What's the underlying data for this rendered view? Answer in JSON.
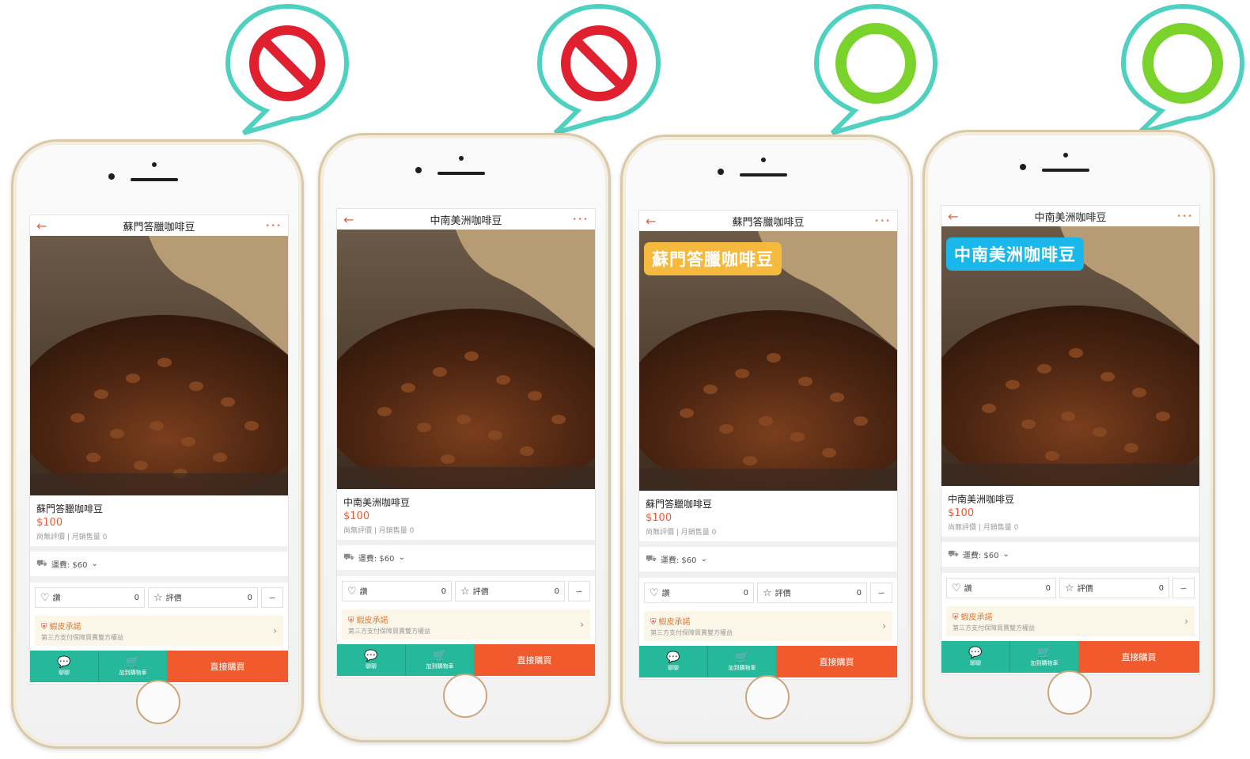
{
  "phones": [
    {
      "badge": "prohibited",
      "nav_title": "蘇門答臘咖啡豆",
      "overlay_tag": "",
      "product_name": "蘇門答臘咖啡豆",
      "price": "$100",
      "meta": "尚無評價 | 月銷售量 0",
      "shipping": "運費: $60",
      "like_label": "讚",
      "like_count": "0",
      "rating_label": "評價",
      "rating_count": "0",
      "promise_title": "蝦皮承諾",
      "promise_sub": "第三方支付保障買賣雙方權益",
      "chat_label": "聊聊",
      "cart_label": "加到購物車",
      "buy_label": "直接購買"
    },
    {
      "badge": "prohibited",
      "nav_title": "中南美洲咖啡豆",
      "overlay_tag": "",
      "product_name": "中南美洲咖啡豆",
      "price": "$100",
      "meta": "尚無評價 | 月銷售量 0",
      "shipping": "運費: $60",
      "like_label": "讚",
      "like_count": "0",
      "rating_label": "評價",
      "rating_count": "0",
      "promise_title": "蝦皮承諾",
      "promise_sub": "第三方支付保障買賣雙方權益",
      "chat_label": "聊聊",
      "cart_label": "加到購物車",
      "buy_label": "直接購買"
    },
    {
      "badge": "ok",
      "nav_title": "蘇門答臘咖啡豆",
      "overlay_tag": "蘇門答臘咖啡豆",
      "overlay_color": "#f5b93e",
      "product_name": "蘇門答臘咖啡豆",
      "price": "$100",
      "meta": "尚無評價 | 月銷售量 0",
      "shipping": "運費: $60",
      "like_label": "讚",
      "like_count": "0",
      "rating_label": "評價",
      "rating_count": "0",
      "promise_title": "蝦皮承諾",
      "promise_sub": "第三方支付保障買賣雙方權益",
      "chat_label": "聊聊",
      "cart_label": "加到購物車",
      "buy_label": "直接購買"
    },
    {
      "badge": "ok",
      "nav_title": "中南美洲咖啡豆",
      "overlay_tag": "中南美洲咖啡豆",
      "overlay_color": "#1ab7ea",
      "product_name": "中南美洲咖啡豆",
      "price": "$100",
      "meta": "尚無評價 | 月銷售量 0",
      "shipping": "運費: $60",
      "like_label": "讚",
      "like_count": "0",
      "rating_label": "評價",
      "rating_count": "0",
      "promise_title": "蝦皮承諾",
      "promise_sub": "第三方支付保障買賣雙方權益",
      "chat_label": "聊聊",
      "cart_label": "加到購物車",
      "buy_label": "直接購買"
    }
  ],
  "colors": {
    "bubble_border": "#4fd1c1",
    "prohibited_red": "#e0202f",
    "ok_green": "#7ad32a",
    "accent_orange": "#f05a2c",
    "bar_teal": "#25b89a"
  },
  "icons": {
    "back": "arrow-left-icon",
    "more": "more-dots-icon",
    "truck": "truck-icon",
    "heart": "heart-icon",
    "star": "star-icon",
    "share": "share-icon",
    "shield": "shield-icon",
    "chevron": "chevron-right-icon",
    "chat": "chat-icon",
    "cart": "cart-icon"
  }
}
